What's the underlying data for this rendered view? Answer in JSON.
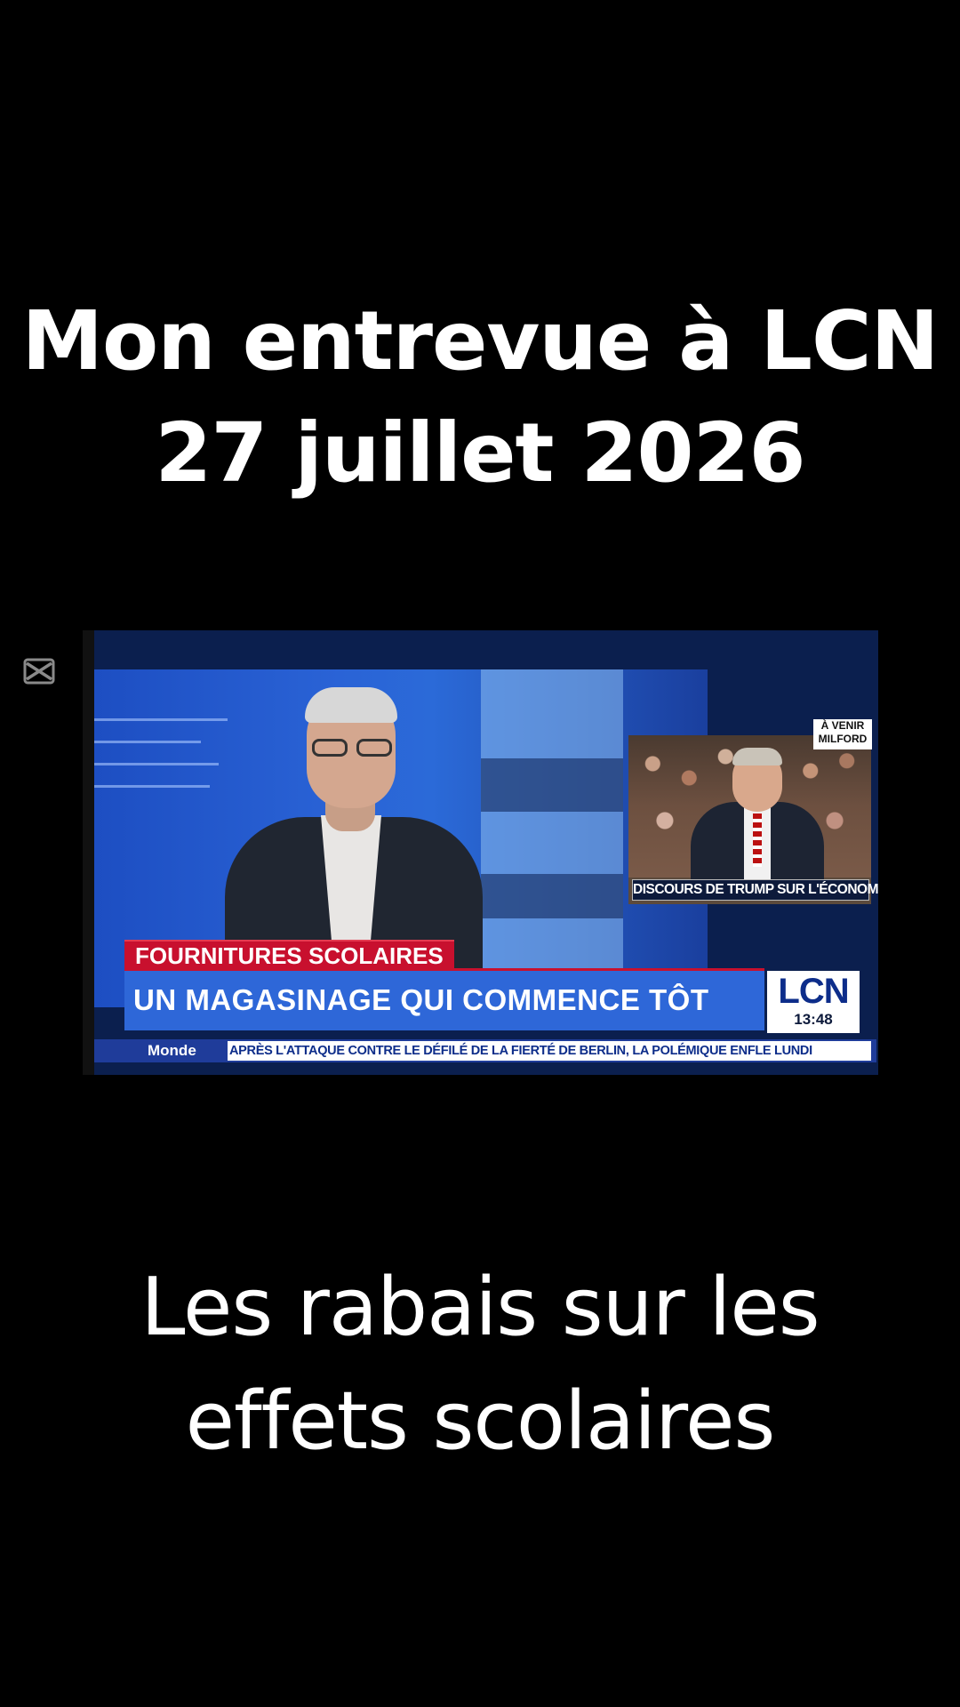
{
  "title": {
    "line1": "Mon entrevue à LCN",
    "line2": "27 juillet 2026"
  },
  "caption": {
    "line1": "Les rabais sur les",
    "line2": "effets scolaires"
  },
  "video": {
    "pip_tag_line1": "À VENIR",
    "pip_tag_line2": "MILFORD",
    "pip_caption": "DISCOURS DE TRUMP SUR L'ÉCONOMIE",
    "topic": "FOURNITURES SCOLAIRES",
    "headline": "UN MAGASINAGE QUI COMMENCE TÔT",
    "channel": "LCN",
    "time": "13:48",
    "ticker_section": "Monde",
    "ticker_text": "APRÈS L'ATTAQUE CONTRE LE DÉFILÉ DE LA FIERTÉ DE BERLIN, LA POLÉMIQUE ENFLE LUNDI"
  },
  "icons": {
    "watermark": "capcut-icon"
  },
  "colors": {
    "background": "#000000",
    "lcn_red": "#c8102e",
    "lcn_blue": "#2e67d8",
    "lcn_navy": "#0b1f4e"
  }
}
